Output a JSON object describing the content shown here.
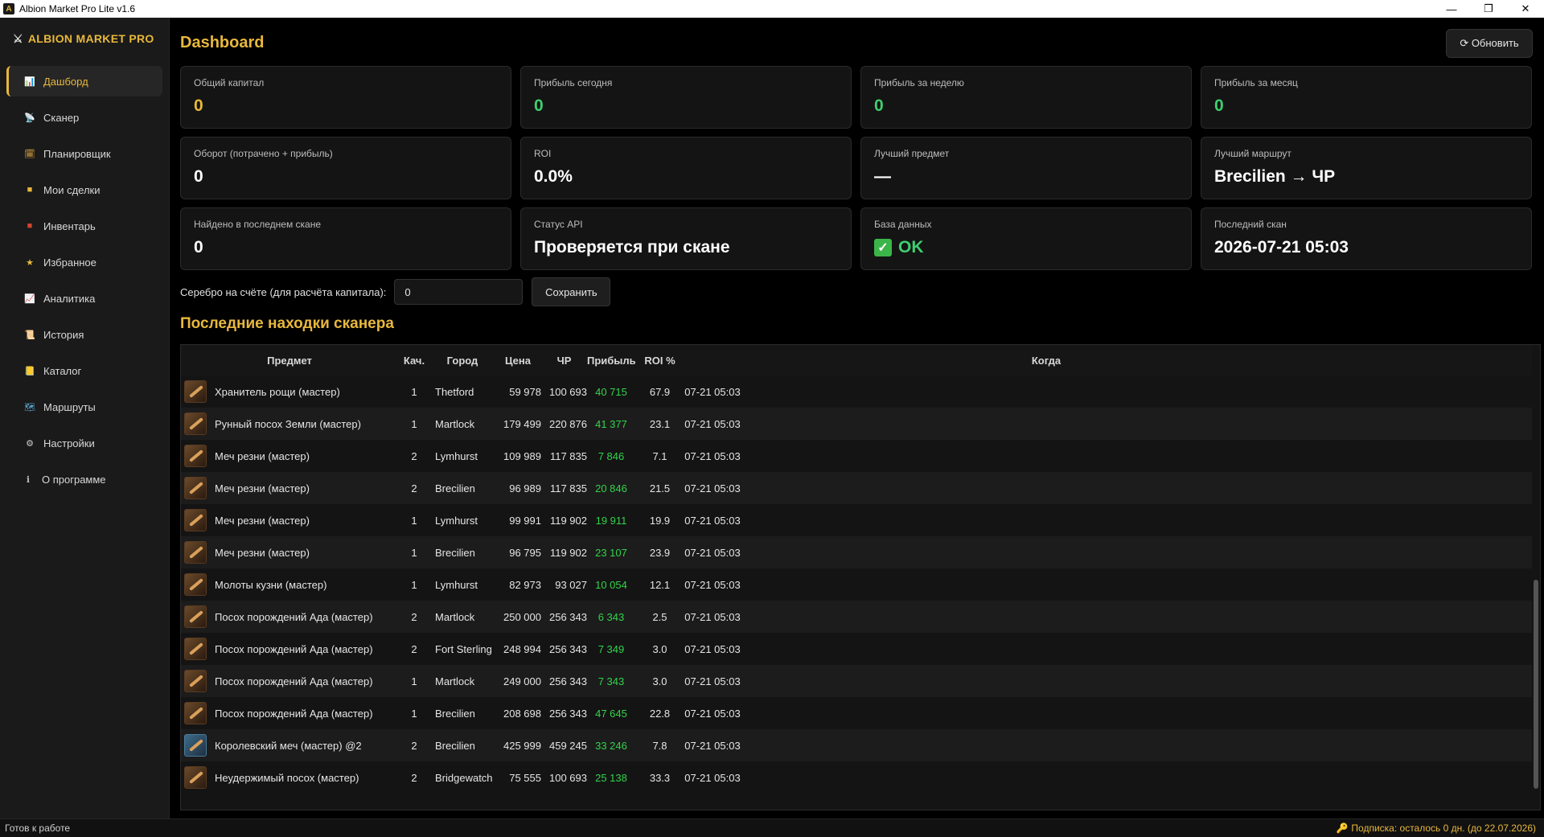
{
  "window": {
    "title": "Albion Market Pro Lite  v1.6",
    "icon_letter": "A",
    "minimize": "—",
    "maximize": "❐",
    "close": "✕"
  },
  "sidebar": {
    "brand": "ALBION MARKET PRO",
    "items": [
      {
        "label": "Дашборд",
        "icon": "📊",
        "icon_name": "dashboard-icon",
        "active": true
      },
      {
        "label": "Сканер",
        "icon": "📡",
        "icon_name": "scanner-icon"
      },
      {
        "label": "Планировщик",
        "icon": "🗓",
        "icon_name": "planner-icon"
      },
      {
        "label": "Мои сделки",
        "icon": "■",
        "icon_name": "deals-icon"
      },
      {
        "label": "Инвентарь",
        "icon": "■",
        "icon_name": "inventory-icon"
      },
      {
        "label": "Избранное",
        "icon": "★",
        "icon_name": "favorites-icon"
      },
      {
        "label": "Аналитика",
        "icon": "📈",
        "icon_name": "analytics-icon"
      },
      {
        "label": "История",
        "icon": "📜",
        "icon_name": "history-icon"
      },
      {
        "label": "Каталог",
        "icon": "📒",
        "icon_name": "catalog-icon"
      },
      {
        "label": "Маршруты",
        "icon": "🗺",
        "icon_name": "routes-icon"
      },
      {
        "label": "Настройки",
        "icon": "⚙",
        "icon_name": "settings-icon"
      },
      {
        "label": "О программе",
        "icon": "ℹ",
        "icon_name": "info-icon"
      }
    ]
  },
  "header": {
    "title": "Dashboard",
    "refresh_label": "⟳ Обновить"
  },
  "cards": [
    {
      "label": "Общий капитал",
      "value": "0",
      "color": "gold"
    },
    {
      "label": "Прибыль сегодня",
      "value": "0",
      "color": "green"
    },
    {
      "label": "Прибыль за неделю",
      "value": "0",
      "color": "green"
    },
    {
      "label": "Прибыль за месяц",
      "value": "0",
      "color": "green"
    },
    {
      "label": "Оборот (потрачено + прибыль)",
      "value": "0",
      "color": "white"
    },
    {
      "label": "ROI",
      "value": "0.0%",
      "color": "white"
    },
    {
      "label": "Лучший предмет",
      "value": "—",
      "color": "white"
    },
    {
      "label": "Лучший маршрут",
      "value": "Brecilien → ЧР",
      "color": "white"
    },
    {
      "label": "Найдено в последнем скане",
      "value": "0",
      "color": "white"
    },
    {
      "label": "Статус API",
      "value": "Проверяется при скане",
      "color": "white"
    },
    {
      "label": "База данных",
      "value": "OK",
      "color": "green",
      "check": "✓"
    },
    {
      "label": "Последний скан",
      "value": "2026-07-21 05:03",
      "color": "white"
    }
  ],
  "silver": {
    "label": "Серебро на счёте (для расчёта капитала):",
    "value": "0",
    "save_label": "Сохранить"
  },
  "findings": {
    "title": "Последние находки сканера",
    "columns": [
      "Предмет",
      "Кач.",
      "Город",
      "Цена",
      "ЧР",
      "Прибыль",
      "ROI %",
      "Когда"
    ],
    "rows": [
      {
        "item": "Хранитель рощи (мастер)",
        "q": "1",
        "city": "Thetford",
        "price": "59 978",
        "bm": "100 693",
        "profit": "40 715",
        "roi": "67.9",
        "when": "07-21 05:03"
      },
      {
        "item": "Рунный посох Земли (мастер)",
        "q": "1",
        "city": "Martlock",
        "price": "179 499",
        "bm": "220 876",
        "profit": "41 377",
        "roi": "23.1",
        "when": "07-21 05:03"
      },
      {
        "item": "Меч резни (мастер)",
        "q": "2",
        "city": "Lymhurst",
        "price": "109 989",
        "bm": "117 835",
        "profit": "7 846",
        "roi": "7.1",
        "when": "07-21 05:03"
      },
      {
        "item": "Меч резни (мастер)",
        "q": "2",
        "city": "Brecilien",
        "price": "96 989",
        "bm": "117 835",
        "profit": "20 846",
        "roi": "21.5",
        "when": "07-21 05:03"
      },
      {
        "item": "Меч резни (мастер)",
        "q": "1",
        "city": "Lymhurst",
        "price": "99 991",
        "bm": "119 902",
        "profit": "19 911",
        "roi": "19.9",
        "when": "07-21 05:03"
      },
      {
        "item": "Меч резни (мастер)",
        "q": "1",
        "city": "Brecilien",
        "price": "96 795",
        "bm": "119 902",
        "profit": "23 107",
        "roi": "23.9",
        "when": "07-21 05:03"
      },
      {
        "item": "Молоты кузни (мастер)",
        "q": "1",
        "city": "Lymhurst",
        "price": "82 973",
        "bm": "93 027",
        "profit": "10 054",
        "roi": "12.1",
        "when": "07-21 05:03"
      },
      {
        "item": "Посох порождений Ада (мастер)",
        "q": "2",
        "city": "Martlock",
        "price": "250 000",
        "bm": "256 343",
        "profit": "6 343",
        "roi": "2.5",
        "when": "07-21 05:03"
      },
      {
        "item": "Посох порождений Ада (мастер)",
        "q": "2",
        "city": "Fort Sterling",
        "price": "248 994",
        "bm": "256 343",
        "profit": "7 349",
        "roi": "3.0",
        "when": "07-21 05:03"
      },
      {
        "item": "Посох порождений Ада (мастер)",
        "q": "1",
        "city": "Martlock",
        "price": "249 000",
        "bm": "256 343",
        "profit": "7 343",
        "roi": "3.0",
        "when": "07-21 05:03"
      },
      {
        "item": "Посох порождений Ада (мастер)",
        "q": "1",
        "city": "Brecilien",
        "price": "208 698",
        "bm": "256 343",
        "profit": "47 645",
        "roi": "22.8",
        "when": "07-21 05:03"
      },
      {
        "item": "Королевский меч (мастер) @2",
        "q": "2",
        "city": "Brecilien",
        "price": "425 999",
        "bm": "459 245",
        "profit": "33 246",
        "roi": "7.8",
        "when": "07-21 05:03",
        "blue": true
      },
      {
        "item": "Неудержимый посох (мастер)",
        "q": "2",
        "city": "Bridgewatch",
        "price": "75 555",
        "bm": "100 693",
        "profit": "25 138",
        "roi": "33.3",
        "when": "07-21 05:03"
      }
    ]
  },
  "status": {
    "left": "Готов к работе",
    "right": "Подписка: осталось 0 дн. (до 22.07.2026)",
    "key_icon": "🔑"
  },
  "colors": {
    "accent": "#e8b83c",
    "profit": "#32d34b",
    "ok": "#3ecf6e",
    "background": "#000000",
    "panel": "#141414"
  }
}
